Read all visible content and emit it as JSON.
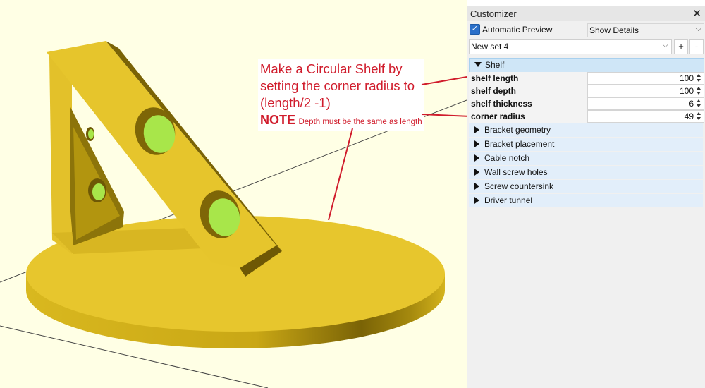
{
  "annotation": {
    "line1": "Make a Circular Shelf by",
    "line2": "setting the corner radius to",
    "line3": "(length/2 -1)",
    "note_label": "NOTE",
    "note_text": "Depth must be the same as length"
  },
  "customizer": {
    "title": "Customizer",
    "close_glyph": "✕",
    "automatic_preview": {
      "label": "Automatic Preview",
      "checked": true
    },
    "details_select": {
      "value": "Show Details"
    },
    "set_select": {
      "value": "New set 4"
    },
    "add_label": "+",
    "remove_label": "-",
    "shelf_group": {
      "label": "Shelf",
      "expanded": true,
      "params": [
        {
          "name": "shelf length",
          "value": "100"
        },
        {
          "name": "shelf depth",
          "value": "100"
        },
        {
          "name": "shelf thickness",
          "value": "6"
        },
        {
          "name": "corner radius",
          "value": "49"
        }
      ]
    },
    "groups": [
      {
        "label": "Bracket geometry"
      },
      {
        "label": "Bracket placement"
      },
      {
        "label": "Cable notch"
      },
      {
        "label": "Wall screw holes"
      },
      {
        "label": "Screw countersink"
      },
      {
        "label": "Driver tunnel"
      }
    ]
  },
  "colors": {
    "viewport_bg": "#ffffe5",
    "model_main": "#e8c72e",
    "model_shadow": "#8a7208",
    "hole": "#a8e64a",
    "annotation_red": "#d01c2c",
    "group_header": "#cfe6f7",
    "checkbox": "#2a6fc9"
  }
}
